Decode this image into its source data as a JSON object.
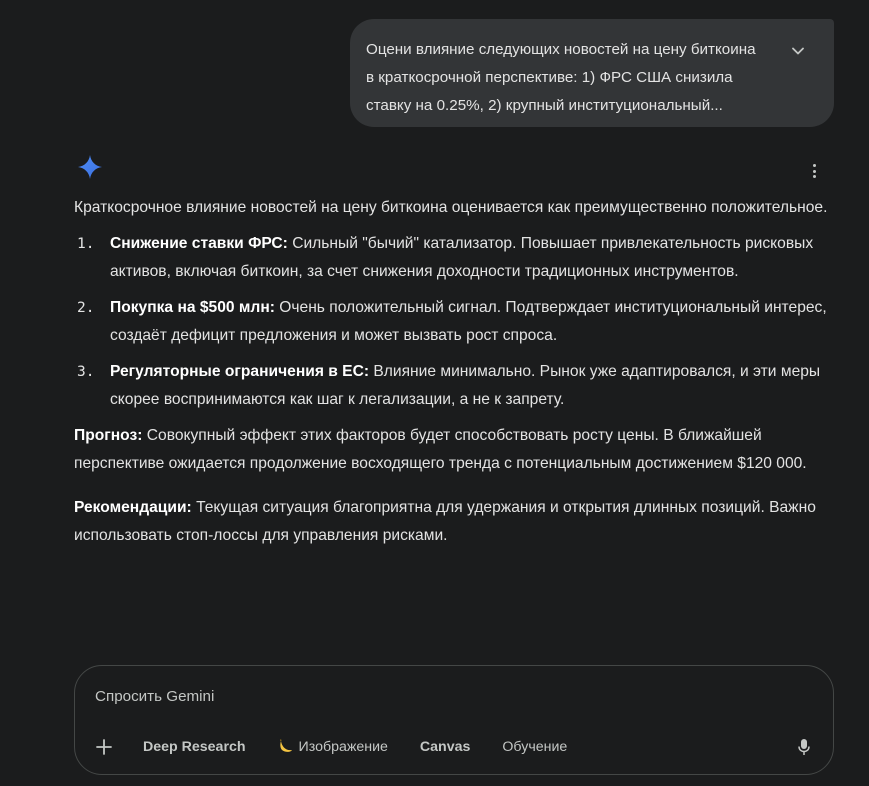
{
  "user_message": {
    "line1": "Оцени влияние следующих новостей на цену биткоина",
    "line2": "в краткосрочной перспективе: 1) ФРС США снизила",
    "line3": "ставку на 0.25%, 2) крупный институциональный..."
  },
  "response": {
    "intro": "Краткосрочное влияние новостей на цену биткоина оценивается как преимущественно положительное.",
    "points": [
      {
        "num": "1.",
        "title": "Снижение ставки ФРС:",
        "text": " Сильный \"бычий\" катализатор. Повышает привлекательность рисковых активов, включая биткоин, за счет снижения доходности традиционных инструментов."
      },
      {
        "num": "2.",
        "title": "Покупка на $500 млн:",
        "text": " Очень положительный сигнал. Подтверждает институциональный интерес, создаёт дефицит предложения и может вызвать рост спроса."
      },
      {
        "num": "3.",
        "title": "Регуляторные ограничения в ЕС:",
        "text": " Влияние минимально. Рынок уже адаптировался, и эти меры скорее воспринимаются как шаг к легализации, а не к запрету."
      }
    ],
    "forecast_label": "Прогноз:",
    "forecast_text": " Совокупный эффект этих факторов будет способствовать росту цены. В ближайшей перспективе ожидается продолжение восходящего тренда с потенциальным достижением $120 000.",
    "recommend_label": "Рекомендации:",
    "recommend_text": " Текущая ситуация благоприятна для удержания и открытия длинных позиций. Важно использовать стоп-лоссы для управления рисками."
  },
  "composer": {
    "placeholder": "Спросить Gemini",
    "tools": {
      "deep_research": "Deep Research",
      "image": "Изображение",
      "canvas": "Canvas",
      "learning": "Обучение"
    }
  },
  "icons": {
    "spark": "gemini-spark-icon",
    "more": "more-vert-icon",
    "expand": "chevron-down-icon",
    "plus": "plus-icon",
    "image_tool": "banana-icon",
    "mic": "microphone-icon"
  },
  "colors": {
    "background": "#1b1c1d",
    "bubble": "#333537",
    "text": "#e3e3e3",
    "muted": "#c4c7c5",
    "spark_blue": "#4f8df5",
    "banana": "#f5c542"
  }
}
